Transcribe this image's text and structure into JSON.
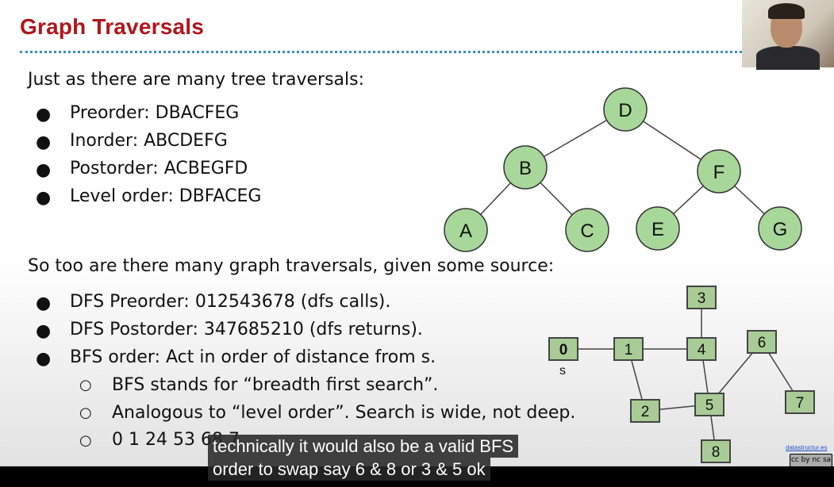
{
  "slide": {
    "title": "Graph Traversals",
    "intro_tree": "Just as there are many tree traversals:",
    "tree_bullets": [
      "Preorder: DBACFEG",
      "Inorder: ABCDEFG",
      "Postorder: ACBEGFD",
      "Level order: DBFACEG"
    ],
    "intro_graph": "So too are there many graph traversals, given some source:",
    "graph_bullets": [
      "DFS Preorder: 012543678 (dfs calls).",
      "DFS Postorder: 347685210 (dfs returns).",
      "BFS order: Act in order of distance from s."
    ],
    "sub_bullets": [
      "BFS stands for “breadth first search”.",
      "Analogous to “level order”. Search is wide, not deep.",
      "0 1 24 53 68 7"
    ],
    "bullet_glyph": "●",
    "sub_bullet_glyph": "○",
    "tree_nodes": [
      "D",
      "B",
      "F",
      "A",
      "C",
      "E",
      "G"
    ],
    "graph_nodes": [
      "0",
      "1",
      "2",
      "3",
      "4",
      "5",
      "6",
      "7",
      "8"
    ],
    "source_label": "s",
    "credit": "datastructur.es",
    "license": "cc by nc sa"
  },
  "caption": {
    "line1": "technically it would also be a valid BFS",
    "line2": "order to swap say 6 & 8 or 3 & 5 ok"
  },
  "colors": {
    "title": "#b0161a",
    "node_fill": "#a8d79a",
    "box_fill": "#a9cc97",
    "rule": "#3a8bbf"
  }
}
